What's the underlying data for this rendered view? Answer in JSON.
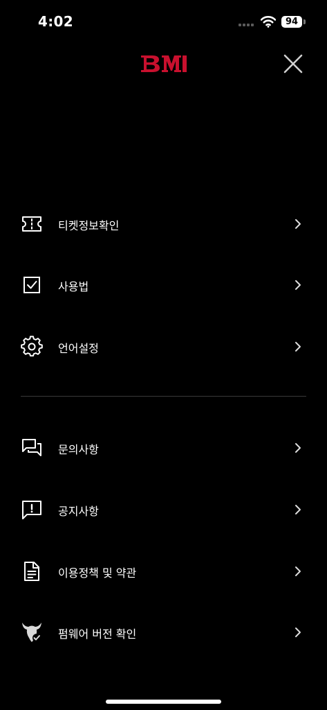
{
  "status_bar": {
    "time": "4:02",
    "battery": "94"
  },
  "header": {
    "logo_text": "BM",
    "brand_color": "#c8102e"
  },
  "menu": {
    "items": [
      {
        "label": "티켓정보확인",
        "icon": "ticket-icon"
      },
      {
        "label": "사용법",
        "icon": "checkbox-icon"
      },
      {
        "label": "언어설정",
        "icon": "gear-icon"
      },
      {
        "label": "문의사항",
        "icon": "chat-bubbles-icon"
      },
      {
        "label": "공지사항",
        "icon": "notice-bubble-icon"
      },
      {
        "label": "이용정책 및 약관",
        "icon": "document-icon"
      },
      {
        "label": "펌웨어 버전 확인",
        "icon": "devil-check-icon"
      }
    ]
  }
}
